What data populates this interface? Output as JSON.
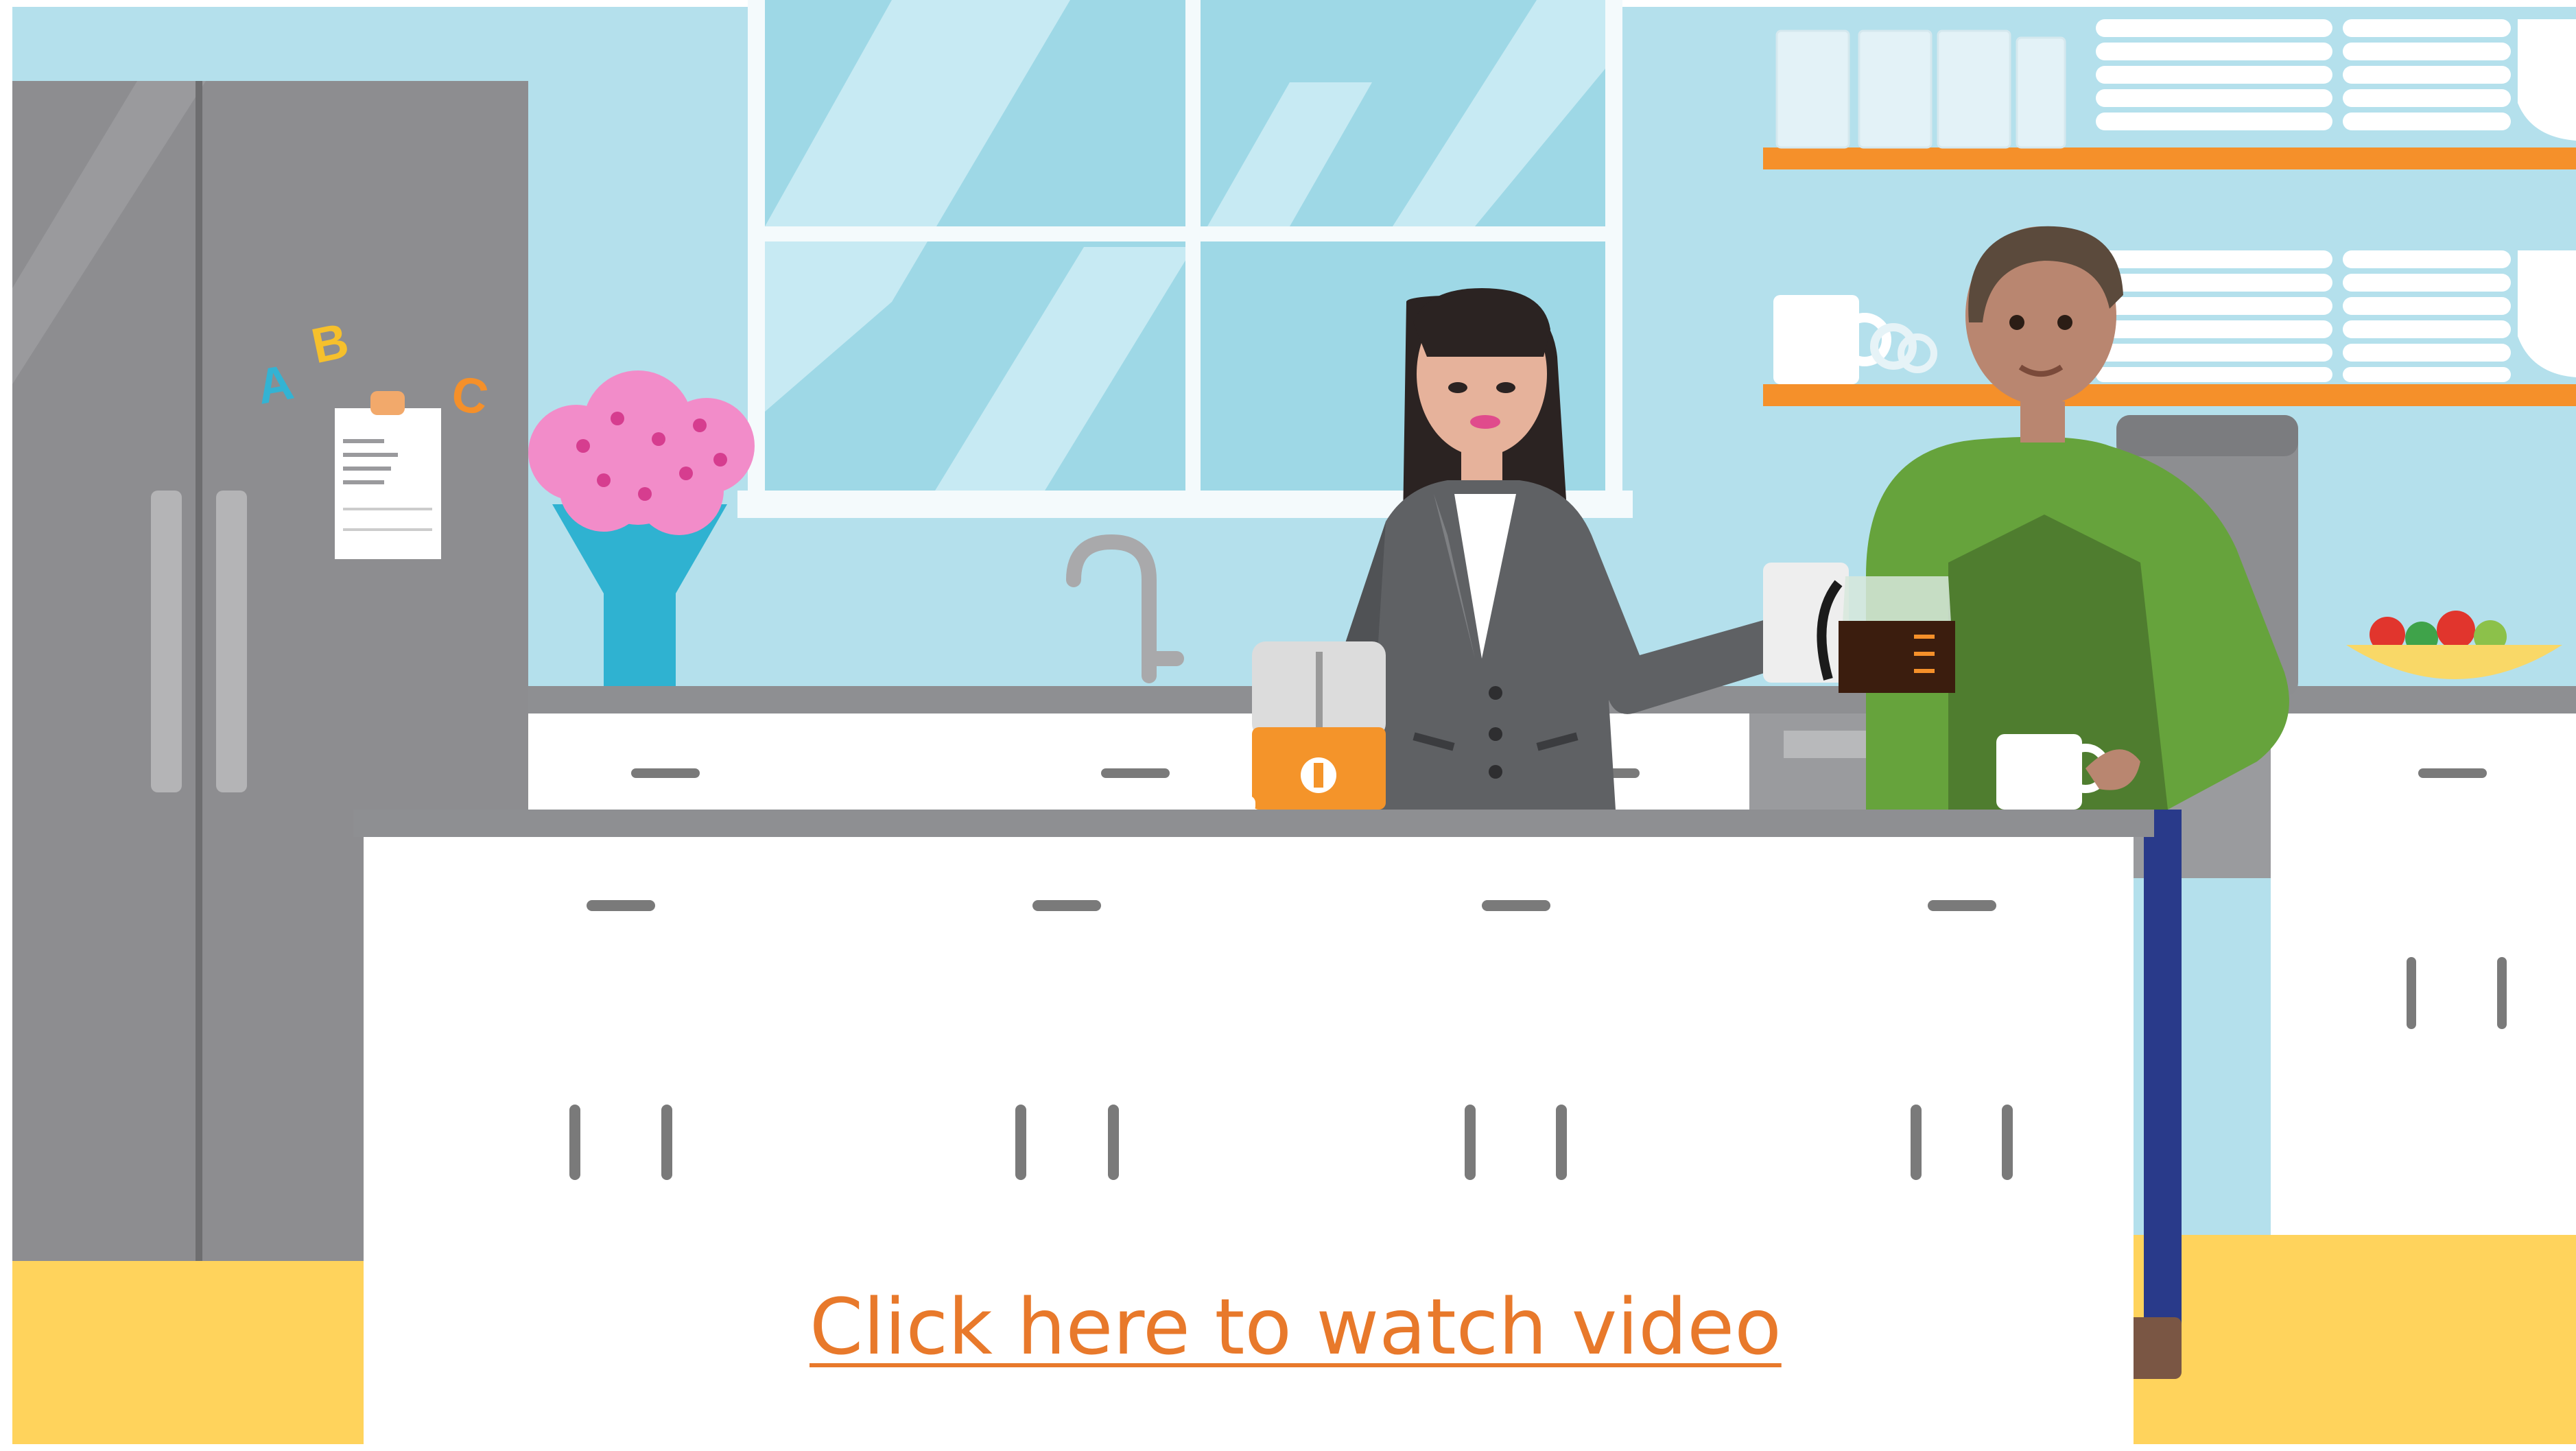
{
  "scene": {
    "title": "",
    "link_label": "Click here to watch video",
    "magnets": [
      "A",
      "B",
      "C"
    ]
  },
  "colors": {
    "wall": "#b4e0ec",
    "floor": "#ffd35c",
    "fridge": "#8a8a8c",
    "island": "#ffffff",
    "shelf": "#f5902a",
    "link": "#e8792b",
    "vase": "#2fb2d1",
    "flowers": "#f28cc9",
    "woman_jacket": "#5f6164",
    "man_sweater": "#66a33c",
    "toaster_base": "#f4942a",
    "coffee": "#3b1d0e"
  },
  "icons": [
    "refrigerator",
    "window",
    "sink-faucet",
    "flower-vase",
    "toaster",
    "coffee-pot",
    "coffee-mug",
    "fruit-bowl",
    "clipboard",
    "glasses",
    "plates",
    "coffee-machine"
  ]
}
